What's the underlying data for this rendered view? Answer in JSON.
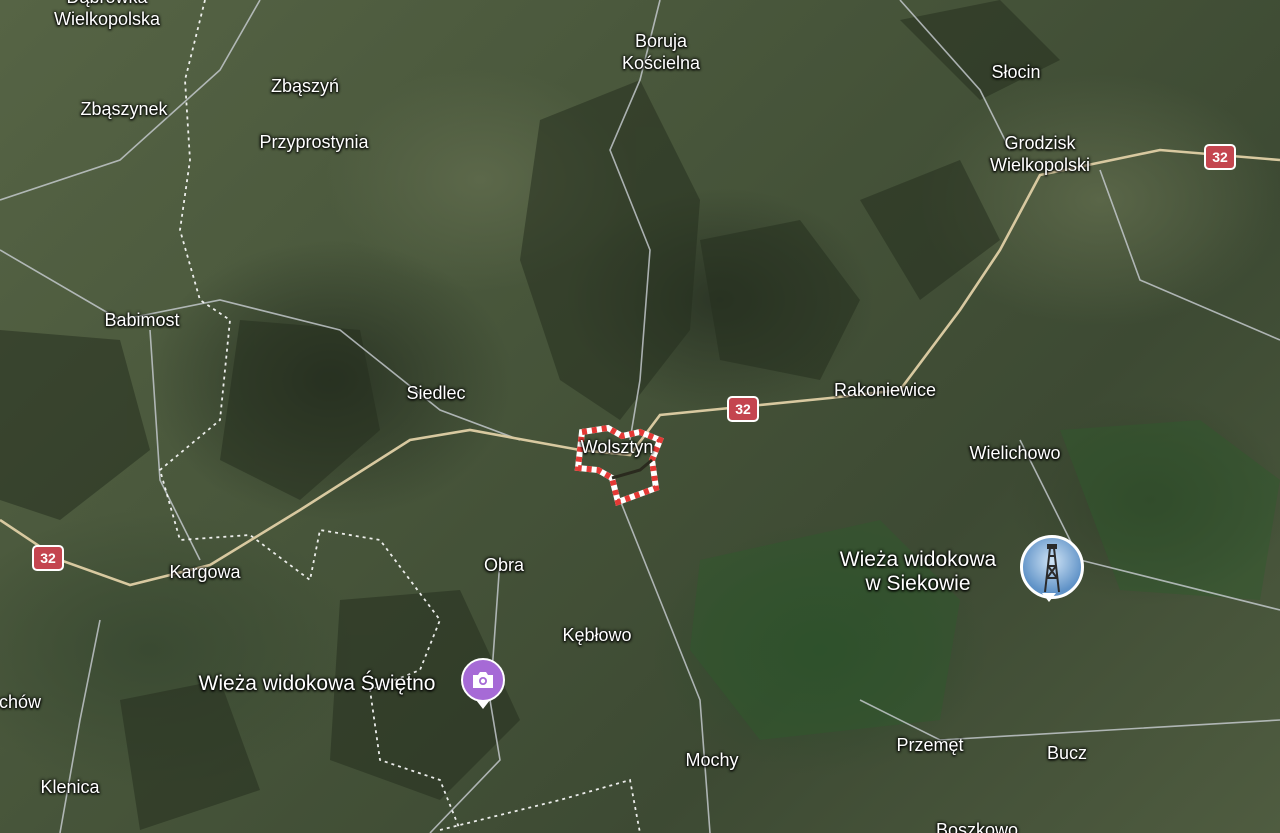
{
  "places": {
    "dabrowka": "Dąbrówka\nWielkopolska",
    "zbaszynek": "Zbąszynek",
    "zbaszyn": "Zbąszyń",
    "przyprostynia": "Przyprostynia",
    "boruja": "Boruja\nKościelna",
    "slocin": "Słocin",
    "grodzisk": "Grodzisk\nWielkopolski",
    "babimost": "Babimost",
    "siedlec": "Siedlec",
    "wolsztyn": "Wolsztyn",
    "rakoniewice": "Rakoniewice",
    "wielichowo": "Wielichowo",
    "kargowa": "Kargowa",
    "obra": "Obra",
    "keblowo": "Kębłowo",
    "siekowo_tower": "Wieża widokowa\nw Siekowie",
    "swietno_tower": "Wieża widokowa Świętno",
    "chow": "chów",
    "klenica": "Klenica",
    "mochy": "Mochy",
    "przemet": "Przemęt",
    "bucz": "Bucz",
    "boszkowo": "Boszkowo"
  },
  "road_shields": {
    "west": "32",
    "center": "32",
    "east": "32"
  },
  "pois": {
    "siekowo_icon": "lookout-tower-photo-icon",
    "swietno_icon": "camera-icon"
  },
  "colors": {
    "road": "#d8c9a0",
    "minor_road": "#c9ced3",
    "border": "#ffffff",
    "shield": "#c4454f",
    "boundary_stripe": "#e53935",
    "poi_purple": "#a66ad6"
  }
}
